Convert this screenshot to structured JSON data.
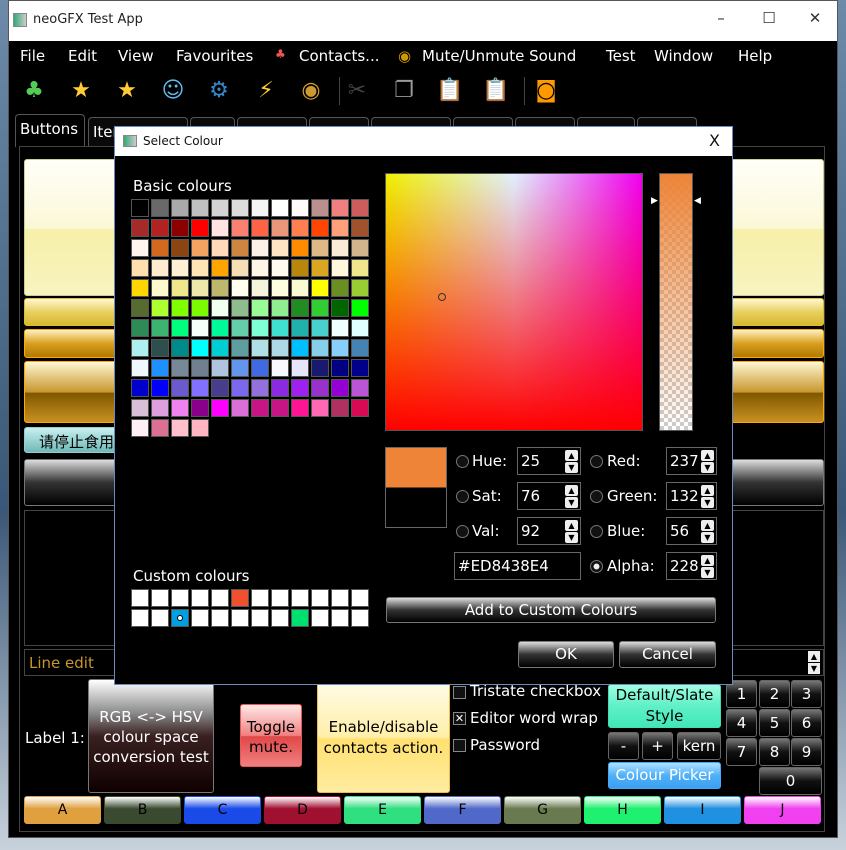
{
  "window": {
    "title": "neoGFX Test App",
    "minimize": "–",
    "maximize": "☐",
    "close": "✕"
  },
  "menu": [
    "File",
    "Edit",
    "View",
    "Favourites",
    "Contacts...",
    "Mute/Unmute Sound",
    "Test",
    "Window",
    "Help"
  ],
  "toolbar": [
    "contacts-icon",
    "add-favourite-icon",
    "organize-favourites-icon",
    "find-contact-icon",
    "settings-icon",
    "plugins-icon",
    "sound-icon",
    "cut-icon",
    "copy-icon",
    "paste-icon",
    "paste-and-go-icon",
    "media-icon"
  ],
  "tabs": [
    "Buttons",
    "Item"
  ],
  "main": {
    "chinese_button": "请停止食用",
    "line_edit": "Line edit",
    "label1": "Label 1:",
    "rgb_hsv_button": "RGB <-> HSV colour space conversion test",
    "toggle_mute": "Toggle mute.",
    "enable_contacts": "Enable/disable contacts action.",
    "checkboxes": [
      {
        "label": "Tristate checkbox",
        "checked": false
      },
      {
        "label": "Editor word wrap",
        "checked": true
      },
      {
        "label": "Password",
        "checked": false
      }
    ],
    "style_button": "Default/Slate Style",
    "minus": "-",
    "plus": "+",
    "kern": "kern",
    "colour_picker": "Colour Picker",
    "numpad": [
      "1",
      "2",
      "3",
      "4",
      "5",
      "6",
      "7",
      "8",
      "9",
      "0"
    ],
    "letters": [
      {
        "l": "A",
        "c": "#e0a040"
      },
      {
        "l": "B",
        "c": "#3a4a30"
      },
      {
        "l": "C",
        "c": "#1a4ae8"
      },
      {
        "l": "D",
        "c": "#a01030"
      },
      {
        "l": "E",
        "c": "#30e080"
      },
      {
        "l": "F",
        "c": "#5068c8"
      },
      {
        "l": "G",
        "c": "#6a7a50"
      },
      {
        "l": "H",
        "c": "#20f070"
      },
      {
        "l": "I",
        "c": "#2090e0"
      },
      {
        "l": "J",
        "c": "#f040f0"
      }
    ]
  },
  "dialog": {
    "title": "Select Colour",
    "close": "X",
    "basic_label": "Basic colours",
    "basic": [
      "#000000",
      "#696969",
      "#a9a9a9",
      "#c0c0c0",
      "#d3d3d3",
      "#dcdcdc",
      "#f5f5f5",
      "#ffffff",
      "#fffafa",
      "#bc8f8f",
      "#f08080",
      "#cd5c5c",
      "#a52a2a",
      "#b22222",
      "#8b0000",
      "#ff0000",
      "#ffe4e1",
      "#fa8072",
      "#ff6347",
      "#e9967a",
      "#ff7f50",
      "#ff4500",
      "#ffa07a",
      "#a0522d",
      "#fff5ee",
      "#d2691e",
      "#8b4513",
      "#f4a460",
      "#ffdab9",
      "#cd853f",
      "#faf0e6",
      "#ffe4c4",
      "#ff8c00",
      "#deb887",
      "#faebd7",
      "#d2b48c",
      "#ffdead",
      "#ffebcd",
      "#ffefd5",
      "#ffe4b5",
      "#ffa500",
      "#f5deb3",
      "#fdf5e6",
      "#fffaf0",
      "#b8860b",
      "#daa520",
      "#fff8dc",
      "#f0e68c",
      "#ffd700",
      "#fffacd",
      "#f0e68c",
      "#eee8aa",
      "#bdb76b",
      "#fffff0",
      "#f5f5dc",
      "#ffffe0",
      "#fafad2",
      "#ffff00",
      "#6b8e23",
      "#9acd32",
      "#556b2f",
      "#adff2f",
      "#7fff00",
      "#7cfc00",
      "#f0fff0",
      "#8fbc8f",
      "#98fb98",
      "#90ee90",
      "#228b22",
      "#32cd32",
      "#006400",
      "#00ff00",
      "#2e8b57",
      "#3cb371",
      "#00ff7f",
      "#f5fffa",
      "#00fa9a",
      "#66cdaa",
      "#7fffd4",
      "#40e0d0",
      "#20b2aa",
      "#48d1cc",
      "#f0ffff",
      "#e0ffff",
      "#afeeee",
      "#2f4f4f",
      "#008b8b",
      "#00ffff",
      "#00ced1",
      "#5f9ea0",
      "#b0e0e6",
      "#add8e6",
      "#00bfff",
      "#87ceeb",
      "#87cefa",
      "#4682b4",
      "#f0f8ff",
      "#1e90ff",
      "#778899",
      "#708090",
      "#b0c4de",
      "#6495ed",
      "#4169e1",
      "#f8f8ff",
      "#e6e6fa",
      "#191970",
      "#000080",
      "#00008b",
      "#0000cd",
      "#0000ff",
      "#6a5acd",
      "#8470ff",
      "#483d8b",
      "#7b68ee",
      "#9370db",
      "#8a2be2",
      "#a020f0",
      "#9932cc",
      "#9400d3",
      "#ba55d3",
      "#d8bfd8",
      "#dda0dd",
      "#ee82ee",
      "#8b008b",
      "#ff00ff",
      "#da70d6",
      "#c71585",
      "#c71585",
      "#ff1493",
      "#ff69b4",
      "#b03060",
      "#d70a53",
      "#fff0f5",
      "#db7093",
      "#ffc0cb",
      "#ffb6c1"
    ],
    "custom_label": "Custom colours",
    "custom": [
      "#ffffff",
      "#ffffff",
      "#ffffff",
      "#ffffff",
      "#ffffff",
      "#f05030",
      "#ffffff",
      "#ffffff",
      "#ffffff",
      "#ffffff",
      "#ffffff",
      "#ffffff",
      "#ffffff",
      "#ffffff",
      "#00a0e0",
      "#ffffff",
      "#ffffff",
      "#ffffff",
      "#ffffff",
      "#ffffff",
      "#00e070",
      "#ffffff",
      "#ffffff",
      "#ffffff"
    ],
    "selected_custom_index": 14,
    "current_colour": "#ED8438",
    "current_alpha": 228,
    "fields": {
      "hue": {
        "label": "Hue:",
        "value": "25"
      },
      "sat": {
        "label": "Sat:",
        "value": "76"
      },
      "val": {
        "label": "Val:",
        "value": "92"
      },
      "red": {
        "label": "Red:",
        "value": "237"
      },
      "green": {
        "label": "Green:",
        "value": "132"
      },
      "blue": {
        "label": "Blue:",
        "value": "56"
      },
      "alpha": {
        "label": "Alpha:",
        "value": "228"
      }
    },
    "selected_channel": "alpha",
    "hex": "#ED8438E4",
    "add_custom": "Add to Custom Colours",
    "ok": "OK",
    "cancel": "Cancel"
  }
}
